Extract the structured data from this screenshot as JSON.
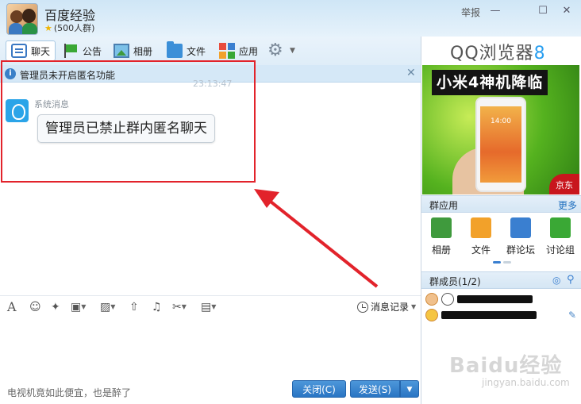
{
  "header": {
    "group_name": "百度经验",
    "group_meta": "(500人群)",
    "report_label": "举报"
  },
  "toolbar": {
    "items": [
      {
        "label": "聊天",
        "icon": "chat-icon"
      },
      {
        "label": "公告",
        "icon": "flag-icon"
      },
      {
        "label": "相册",
        "icon": "photo-icon"
      },
      {
        "label": "文件",
        "icon": "folder-icon"
      },
      {
        "label": "应用",
        "icon": "apps-icon"
      }
    ],
    "settings_icon": "gear-icon"
  },
  "chat": {
    "notice_text": "管理员未开启匿名功能",
    "timestamp": "23:13:47",
    "sender": "系统消息",
    "message": "管理员已禁止群内匿名聊天"
  },
  "input_toolbar": {
    "history_label": "消息记录"
  },
  "input_area": {
    "ad_text": "电视机竟如此便宜，也是醉了",
    "close_button": "关闭(C)",
    "send_button": "发送(S)"
  },
  "right_panel": {
    "browser_brand": "QQ浏览器",
    "browser_version": "8",
    "ad_title": "小米4神机降临",
    "ad_phone_time": "14:00",
    "ad_store": "京东",
    "group_apps_title": "群应用",
    "more_label": "更多",
    "apps": [
      {
        "label": "相册",
        "icon": "album-icon",
        "color": "#3f9a3d"
      },
      {
        "label": "文件",
        "icon": "file-icon",
        "color": "#f2a12a"
      },
      {
        "label": "群论坛",
        "icon": "forum-icon",
        "color": "#3a7fd0"
      },
      {
        "label": "讨论组",
        "icon": "discussion-icon",
        "color": "#3aa835"
      }
    ],
    "members_title": "群成员(1/2)"
  },
  "watermark": {
    "text": "Baidu经验",
    "sub": "jingyan.baidu.com"
  },
  "colors": {
    "accent_blue": "#2a75c3",
    "highlight_red": "#e2232b",
    "notice_bg": "#d5e8f7"
  }
}
